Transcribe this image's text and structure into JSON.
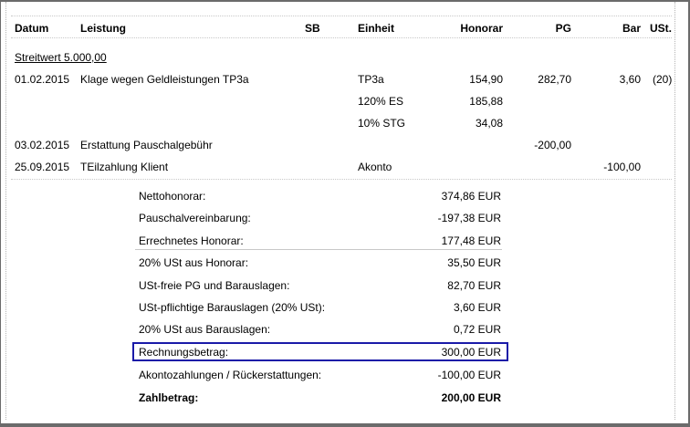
{
  "header": {
    "datum": "Datum",
    "leistung": "Leistung",
    "sb": "SB",
    "einheit": "Einheit",
    "honorar": "Honorar",
    "pg": "PG",
    "bar": "Bar",
    "ust": "USt."
  },
  "streitwert": "Streitwert 5.000,00",
  "rows": [
    {
      "datum": "01.02.2015",
      "leistung": "Klage wegen Geldleistungen TP3a",
      "einheit": "TP3a",
      "honorar": "154,90",
      "pg": "282,70",
      "bar": "3,60",
      "ust": "(20)"
    },
    {
      "datum": "",
      "leistung": "",
      "einheit": "120% ES",
      "honorar": "185,88",
      "pg": "",
      "bar": "",
      "ust": ""
    },
    {
      "datum": "",
      "leistung": "",
      "einheit": "10% STG",
      "honorar": "34,08",
      "pg": "",
      "bar": "",
      "ust": ""
    },
    {
      "datum": "03.02.2015",
      "leistung": "Erstattung Pauschalgebühr",
      "einheit": "",
      "honorar": "",
      "pg": "-200,00",
      "bar": "",
      "ust": ""
    },
    {
      "datum": "25.09.2015",
      "leistung": "TEilzahlung Klient",
      "einheit": "Akonto",
      "honorar": "",
      "pg": "",
      "bar": "-100,00",
      "ust": ""
    }
  ],
  "summary": [
    {
      "label": "Nettohonorar:",
      "value": "374,86 EUR"
    },
    {
      "label": "Pauschalvereinbarung:",
      "value": "-197,38 EUR"
    },
    {
      "label": "Errechnetes Honorar:",
      "value": "177,48 EUR"
    },
    {
      "label": "20% USt aus Honorar:",
      "value": "35,50 EUR"
    },
    {
      "label": "USt-freie PG und Barauslagen:",
      "value": "82,70 EUR"
    },
    {
      "label": "USt-pflichtige Barauslagen (20% USt):",
      "value": "3,60 EUR"
    },
    {
      "label": "20% USt aus Barauslagen:",
      "value": "0,72 EUR"
    },
    {
      "label": "Rechnungsbetrag:",
      "value": "300,00 EUR"
    },
    {
      "label": "Akontozahlungen / Rückerstattungen:",
      "value": "-100,00 EUR"
    },
    {
      "label": "Zahlbetrag:",
      "value": "200,00 EUR"
    }
  ],
  "colors": {
    "highlight": "#1a1aa8",
    "frame": "#6b6b6b"
  }
}
